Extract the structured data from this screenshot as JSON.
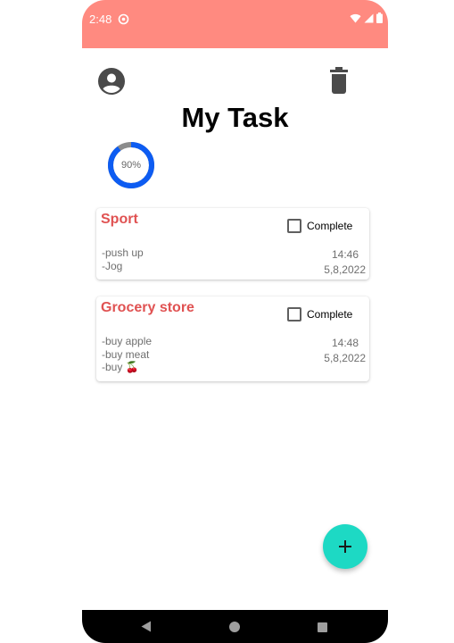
{
  "status_bar": {
    "time": "2:48",
    "background_color": "#ff8a80",
    "icons": [
      "app-notification-icon",
      "wifi-icon",
      "signal-icon",
      "battery-icon"
    ]
  },
  "header": {
    "title": "My Task",
    "profile_icon": "account-circle-icon",
    "delete_icon": "trash-icon"
  },
  "progress": {
    "label": "90%",
    "value": 0.9,
    "ring_color": "#0d5cf2",
    "track_color": "#8c8c8c"
  },
  "tasks": [
    {
      "title": "Sport",
      "complete_label": "Complete",
      "checked": false,
      "notes": [
        "-push up",
        "-Jog"
      ],
      "time": "14:46",
      "date": "5,8,2022"
    },
    {
      "title": "Grocery store",
      "complete_label": "Complete",
      "checked": false,
      "notes": [
        "-buy apple",
        "-buy meat",
        "-buy 🍒"
      ],
      "time": "14:48",
      "date": "5,8,2022"
    }
  ],
  "fab": {
    "icon": "plus-icon",
    "color": "#1dd9c4"
  },
  "nav_bar": {
    "icons": [
      "back-icon",
      "home-icon",
      "recents-icon"
    ]
  }
}
